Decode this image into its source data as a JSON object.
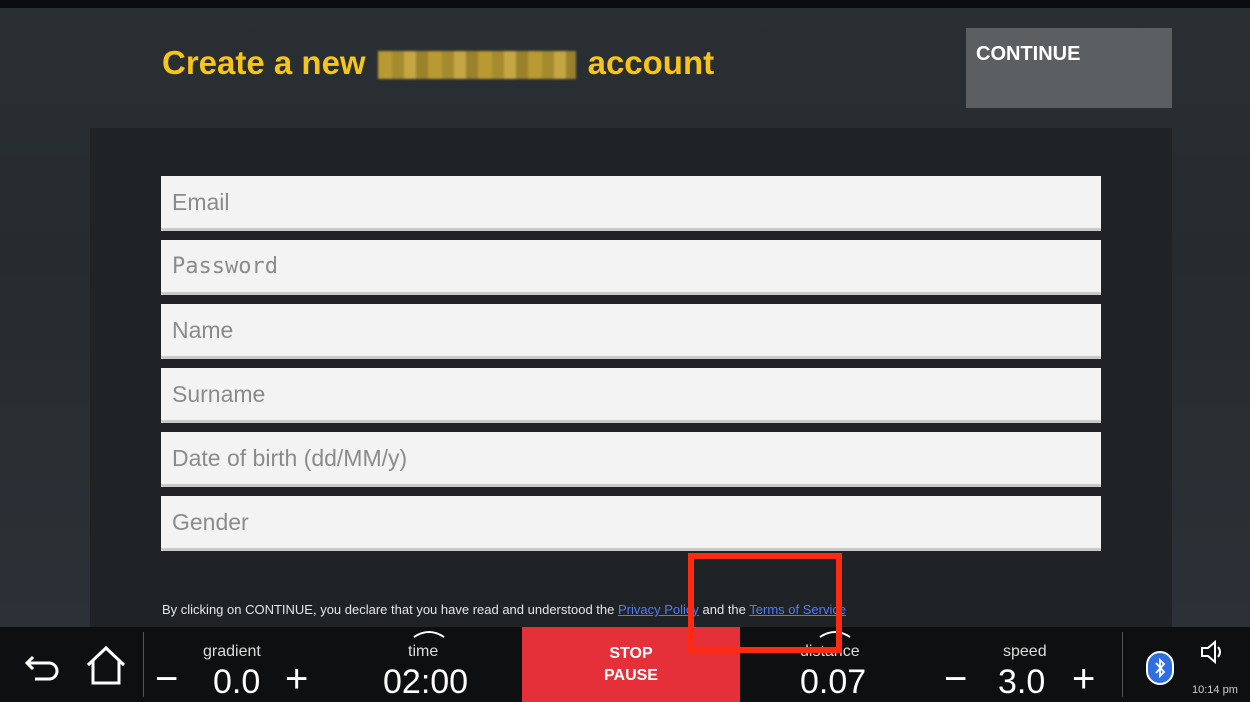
{
  "header": {
    "title_prefix": "Create a new",
    "title_suffix": "account",
    "continue_label": "CONTINUE"
  },
  "form": {
    "fields": [
      {
        "placeholder": "Email",
        "value": ""
      },
      {
        "placeholder": "Password",
        "value": ""
      },
      {
        "placeholder": "Name",
        "value": ""
      },
      {
        "placeholder": "Surname",
        "value": ""
      },
      {
        "placeholder": "Date of birth (dd/MM/y)",
        "value": ""
      },
      {
        "placeholder": "Gender",
        "value": ""
      }
    ],
    "consent": {
      "prefix": "By clicking on CONTINUE, you declare that you have read and understood the ",
      "privacy_link": "Privacy Policy",
      "middle": " and the ",
      "terms_link": "Terms of Service"
    }
  },
  "bottom_bar": {
    "gradient": {
      "label": "gradient",
      "value": "0.0",
      "minus": "−",
      "plus": "+"
    },
    "time": {
      "label": "time",
      "value": "02:00"
    },
    "stop_pause": {
      "stop": "STOP",
      "pause": "PAUSE"
    },
    "distance": {
      "label": "distance",
      "value": "0.07"
    },
    "speed": {
      "label": "speed",
      "value": "3.0",
      "minus": "−",
      "plus": "+"
    },
    "clock": "10:14 pm"
  },
  "icons": {
    "back": "back-arrow-icon",
    "home": "home-icon",
    "bluetooth": "bluetooth-icon",
    "volume": "volume-icon"
  },
  "colors": {
    "title": "#f6c518",
    "stop_button": "#e5303a",
    "link": "#4f7bff",
    "highlight": "#ff2a12"
  }
}
